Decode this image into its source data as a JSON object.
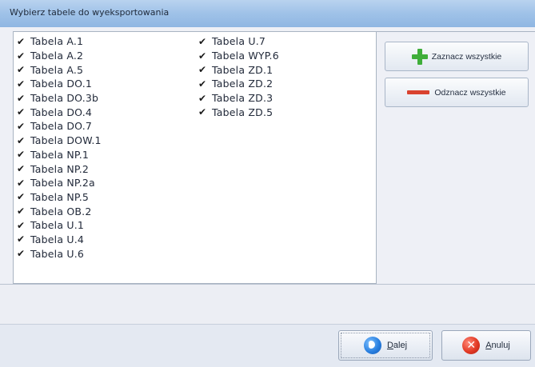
{
  "window": {
    "title": "Wybierz tabele do wyeksportowania"
  },
  "checklist": {
    "column1": [
      {
        "label": "Tabela A.1",
        "checked": true
      },
      {
        "label": "Tabela A.2",
        "checked": true
      },
      {
        "label": "Tabela A.5",
        "checked": true
      },
      {
        "label": "Tabela DO.1",
        "checked": true
      },
      {
        "label": "Tabela DO.3b",
        "checked": true
      },
      {
        "label": "Tabela DO.4",
        "checked": true
      },
      {
        "label": "Tabela DO.7",
        "checked": true
      },
      {
        "label": "Tabela DOW.1",
        "checked": true
      },
      {
        "label": "Tabela NP.1",
        "checked": true
      },
      {
        "label": "Tabela NP.2",
        "checked": true
      },
      {
        "label": "Tabela NP.2a",
        "checked": true
      },
      {
        "label": "Tabela NP.5",
        "checked": true
      },
      {
        "label": "Tabela OB.2",
        "checked": true
      },
      {
        "label": "Tabela U.1",
        "checked": true
      },
      {
        "label": "Tabela U.4",
        "checked": true
      },
      {
        "label": "Tabela U.6",
        "checked": true
      }
    ],
    "column2": [
      {
        "label": "Tabela U.7",
        "checked": true
      },
      {
        "label": "Tabela WYP.6",
        "checked": true
      },
      {
        "label": "Tabela ZD.1",
        "checked": true
      },
      {
        "label": "Tabela ZD.2",
        "checked": true
      },
      {
        "label": "Tabela ZD.3",
        "checked": true
      },
      {
        "label": "Tabela ZD.5",
        "checked": true
      }
    ],
    "check_glyph": "✔"
  },
  "actions": {
    "select_all_label": "Zaznacz wszystkie",
    "deselect_all_label": "Odznacz wszystkie",
    "select_all_icon": "plus-icon",
    "deselect_all_icon": "minus-icon"
  },
  "footer": {
    "next_label": "Dalej",
    "cancel_label": "Anuluj",
    "next_icon": "arrow-right-icon",
    "cancel_icon": "cancel-icon"
  },
  "colors": {
    "plus_green": "#3fae3a",
    "minus_red": "#d9432f",
    "next_blue": "#2a80e0",
    "cancel_red": "#e23a25"
  }
}
